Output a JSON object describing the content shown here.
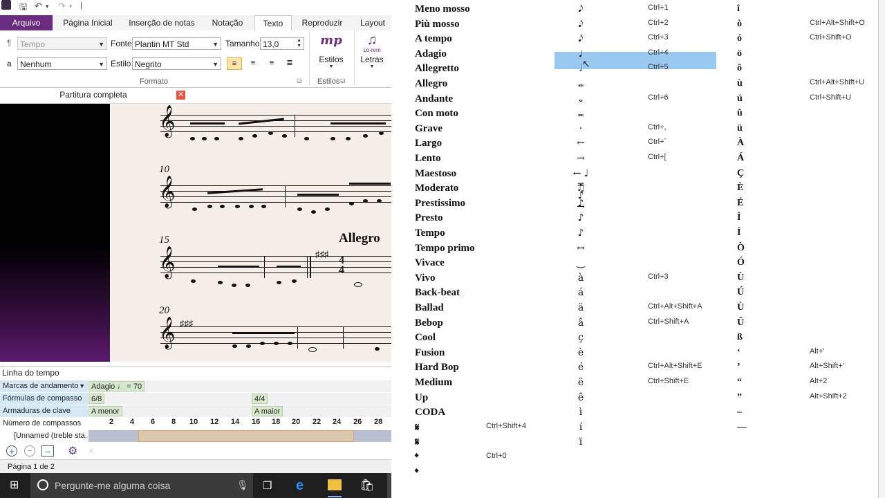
{
  "ribbon": {
    "tabs": [
      "Arquivo",
      "Página Inicial",
      "Inserção de notas",
      "Notação",
      "Texto",
      "Reproduzir",
      "Layout"
    ],
    "style_combo": "Tempo",
    "font_label": "Fonte",
    "font_value": "Plantin MT Std",
    "size_label": "Tamanho",
    "size_value": "13,0",
    "char_style_value": "Nenhum",
    "style_label": "Estilo",
    "style_value": "Negrito",
    "group_format": "Formato",
    "group_styles": "Estilos",
    "estilos_btn": "Estilos",
    "mp_glyph": "mp",
    "letras_btn": "Letras",
    "lorem_glyph": "Lo-rem",
    "pilcrow": "¶",
    "a_glyph": "a"
  },
  "document": {
    "tab_title": "Partitura completa",
    "measure_numbers": [
      "10",
      "15",
      "20"
    ],
    "tempo_text": "Allegro"
  },
  "timeline": {
    "title": "Linha do tempo",
    "rows": {
      "tempo_label": "Marcas de andamento",
      "tempo_chip": "Adagio ♩ = 70",
      "time_label": "Fórmulas de compasso",
      "time_chip1": "6/8",
      "time_chip2": "4/4",
      "key_label": "Armaduras de clave",
      "key_chip1": "A menor",
      "key_chip2": "A maior",
      "measures_label": "Número de compassos",
      "measures": [
        "2",
        "4",
        "6",
        "8",
        "10",
        "12",
        "14",
        "16",
        "18",
        "20",
        "22",
        "24",
        "26",
        "28"
      ],
      "staff_label": "[Unnamed (treble sta..."
    }
  },
  "status": {
    "page": "Página 1 de 2"
  },
  "taskbar": {
    "search_placeholder": "Pergunte-me alguma coisa"
  },
  "list": {
    "names": [
      "Meno mosso",
      "Più mosso",
      "A tempo",
      "Adagio",
      "Allegretto",
      "Allegro",
      "Andante",
      "Con moto",
      "Grave",
      "Largo",
      "Lento",
      "Maestoso",
      "Moderato",
      "Prestissimo",
      "Presto",
      "Tempo",
      "Tempo primo",
      "Vivace",
      "Vivo",
      "Back-beat",
      "Ballad",
      "Bebop",
      "Cool",
      "Fusion",
      "Hard Bop",
      "Medium",
      "Up",
      "CODA",
      "𝄋",
      "𝄋",
      "𝄌",
      "𝄌"
    ],
    "col1_shortcuts": [
      {
        "row": 28,
        "text": "Ctrl+Shift+4"
      },
      {
        "row": 30,
        "text": "Ctrl+0"
      }
    ],
    "symbols": [
      "𝅘𝅥𝅮",
      "𝅘𝅥𝅮",
      "𝅘𝅥𝅮",
      "♩",
      "𝅗𝅥",
      "𝅜",
      "𝅝",
      "𝅜",
      "·",
      "←",
      "→",
      "← ♩ = ♪ →",
      "♫",
      "♪",
      "♪",
      "♪",
      "↔",
      "‿",
      "à",
      "á",
      "ä",
      "â",
      "ç",
      "è",
      "é",
      "ë",
      "ê",
      "ì",
      "í",
      "ï"
    ],
    "col2_shortcuts": [
      {
        "row": 0,
        "text": "Ctrl+1"
      },
      {
        "row": 1,
        "text": "Ctrl+2"
      },
      {
        "row": 2,
        "text": "Ctrl+3"
      },
      {
        "row": 3,
        "text": "Ctrl+4"
      },
      {
        "row": 4,
        "text": "Ctrl+5"
      },
      {
        "row": 6,
        "text": "Ctrl+6"
      },
      {
        "row": 8,
        "text": "Ctrl+,"
      },
      {
        "row": 9,
        "text": "Ctrl+´"
      },
      {
        "row": 10,
        "text": "Ctrl+["
      },
      {
        "row": 18,
        "text": "Ctrl+3"
      },
      {
        "row": 20,
        "text": "Ctrl+Alt+Shift+A"
      },
      {
        "row": 21,
        "text": "Ctrl+Shift+A"
      },
      {
        "row": 24,
        "text": "Ctrl+Alt+Shift+E"
      },
      {
        "row": 25,
        "text": "Ctrl+Shift+E"
      }
    ],
    "chars": [
      "î",
      "ò",
      "ó",
      "ö",
      "ô",
      "ù",
      "ú",
      "û",
      "ü",
      "À",
      "Á",
      "Ç",
      "È",
      "É",
      "Ì",
      "Í",
      "Ò",
      "Ó",
      "Ù",
      "Ú",
      "Ù",
      "Û",
      "ß",
      "‘",
      "’",
      "“",
      "”",
      "–",
      "—"
    ],
    "col3_shortcuts": [
      {
        "row": 1,
        "text": "Ctrl+Alt+Shift+O"
      },
      {
        "row": 2,
        "text": "Ctrl+Shift+O"
      },
      {
        "row": 5,
        "text": "Ctrl+Alt+Shift+U"
      },
      {
        "row": 6,
        "text": "Ctrl+Shift+U"
      },
      {
        "row": 23,
        "text": "Alt+'"
      },
      {
        "row": 24,
        "text": "Alt+Shift+'"
      },
      {
        "row": 25,
        "text": "Alt+2"
      },
      {
        "row": 26,
        "text": "Alt+Shift+2"
      }
    ],
    "selected_row": 3
  },
  "colors": {
    "accent": "#6a2c7e",
    "highlight": "#99c9ef",
    "timeline_header": "#d5e8f6"
  }
}
